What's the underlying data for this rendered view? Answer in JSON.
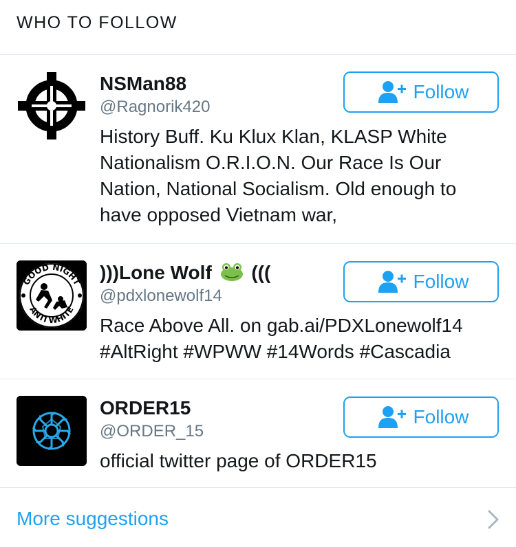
{
  "header": {
    "title": "WHO TO FOLLOW"
  },
  "accounts": [
    {
      "name": "NSMan88",
      "handle": "@Ragnorik420",
      "bio": "History Buff. Ku Klux Klan, KLASP White Nationalism O.R.I.O.N. Our Race Is Our Nation, National Socialism. Old enough to have opposed Vietnam war,",
      "follow_label": "Follow"
    },
    {
      "name_prefix": ")))Lone Wolf",
      "name_suffix": "(((",
      "name_emoji": "frog-emoji-icon",
      "handle": "@pdxlonewolf14",
      "bio": "Race Above All. on gab.ai/PDXLonewolf14 #AltRight #WPWW #14Words #Cascadia",
      "follow_label": "Follow",
      "avatar_text_top": "GOOD NIGHT",
      "avatar_text_bottom": "ANTI WHITE"
    },
    {
      "name": "ORDER15",
      "handle": "@ORDER_15",
      "bio": "official twitter page of ORDER15",
      "follow_label": "Follow"
    }
  ],
  "footer": {
    "more_label": "More suggestions"
  },
  "colors": {
    "accent": "#1da1f2",
    "text": "#14171a",
    "muted": "#657786",
    "divider": "#e1e8ed"
  }
}
